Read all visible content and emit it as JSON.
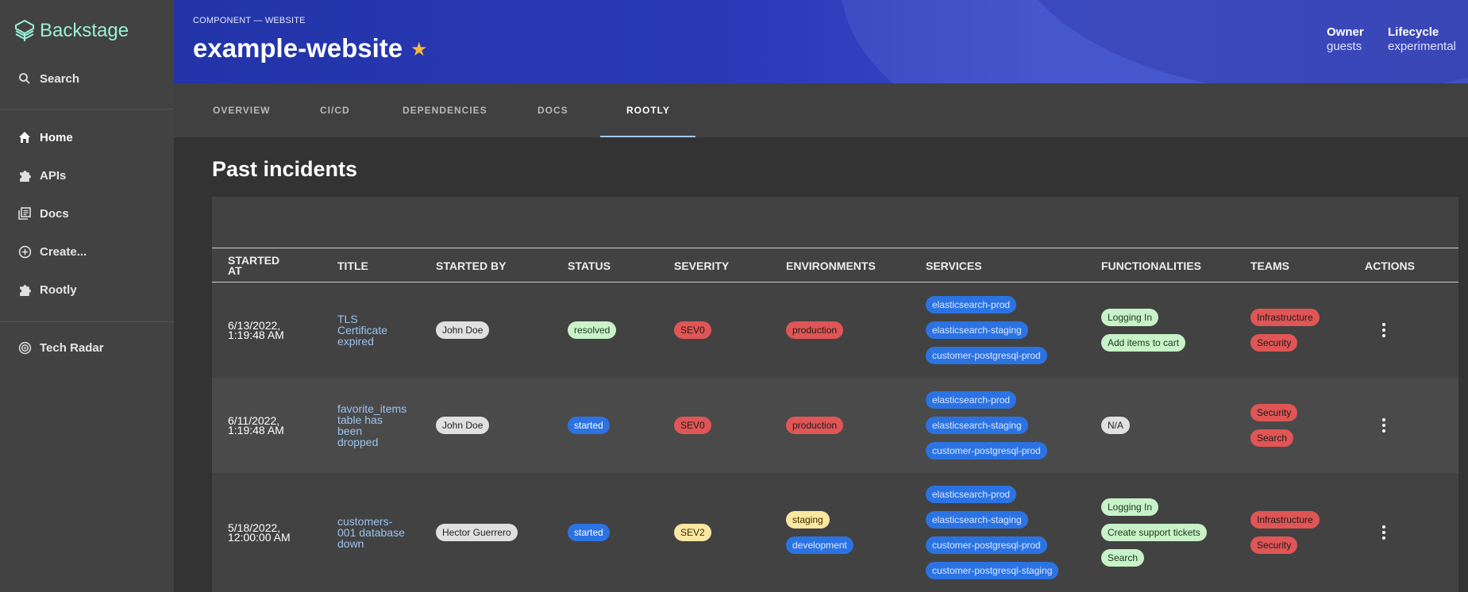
{
  "sidebar": {
    "logo": "Backstage",
    "search": "Search",
    "items": [
      {
        "label": "Home",
        "icon": "home-icon"
      },
      {
        "label": "APIs",
        "icon": "puzzle-icon"
      },
      {
        "label": "Docs",
        "icon": "library-icon"
      },
      {
        "label": "Create...",
        "icon": "add-circle-icon"
      },
      {
        "label": "Rootly",
        "icon": "puzzle-icon"
      }
    ],
    "tech_radar": "Tech Radar"
  },
  "header": {
    "breadcrumb": "COMPONENT — WEBSITE",
    "title": "example-website",
    "owner_label": "Owner",
    "owner_value": "guests",
    "lifecycle_label": "Lifecycle",
    "lifecycle_value": "experimental",
    "star_color": "#f6b93b"
  },
  "tabs": [
    "OVERVIEW",
    "CI/CD",
    "DEPENDENCIES",
    "DOCS",
    "ROOTLY"
  ],
  "active_tab": "ROOTLY",
  "section_title": "Past incidents",
  "table": {
    "columns": [
      "STARTED AT",
      "TITLE",
      "STARTED BY",
      "STATUS",
      "SEVERITY",
      "ENVIRONMENTS",
      "SERVICES",
      "FUNCTIONALITIES",
      "TEAMS",
      "ACTIONS"
    ],
    "rows": [
      {
        "started_at": [
          "6/13/2022,",
          "1:19:48 AM"
        ],
        "title": [
          "TLS",
          "Certificate",
          "expired"
        ],
        "started_by": "John Doe",
        "status": "resolved",
        "severity": "SEV0",
        "environments": [
          "production"
        ],
        "services": [
          "elasticsearch-prod",
          "elasticsearch-staging",
          "customer-postgresql-prod"
        ],
        "functionalities": [
          "Logging In",
          "Add items to cart"
        ],
        "teams": [
          "Infrastructure",
          "Security"
        ]
      },
      {
        "started_at": [
          "6/11/2022,",
          "1:19:48 AM"
        ],
        "title": [
          "favorite_items",
          "table has",
          "been",
          "dropped"
        ],
        "started_by": "John Doe",
        "status": "started",
        "severity": "SEV0",
        "environments": [
          "production"
        ],
        "services": [
          "elasticsearch-prod",
          "elasticsearch-staging",
          "customer-postgresql-prod"
        ],
        "functionalities": [
          "N/A"
        ],
        "teams": [
          "Security",
          "Search"
        ]
      },
      {
        "started_at": [
          "5/18/2022,",
          "12:00:00 AM"
        ],
        "title": [
          "customers-",
          "001 database",
          "down"
        ],
        "started_by": "Hector Guerrero",
        "status": "started",
        "severity": "SEV2",
        "environments": [
          "staging",
          "development"
        ],
        "services": [
          "elasticsearch-prod",
          "elasticsearch-staging",
          "customer-postgresql-prod",
          "customer-postgresql-staging"
        ],
        "functionalities": [
          "Logging In",
          "Create support tickets",
          "Search"
        ],
        "teams": [
          "Infrastructure",
          "Security"
        ]
      }
    ]
  }
}
